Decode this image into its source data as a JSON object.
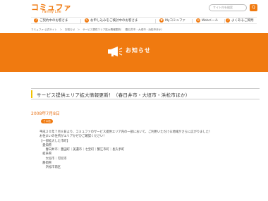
{
  "header": {
    "logo": "コミュファ",
    "logo_sub": "Family Life",
    "search_placeholder": "サイト内を検索",
    "search_button": "Q"
  },
  "nav": {
    "items": [
      {
        "icon": "?",
        "label": "ご契約中のお客さま"
      },
      {
        "icon": "✎",
        "label": "お申し込みをご検討中のお客さま"
      },
      {
        "icon": "♥",
        "label": "Myコミュファ"
      },
      {
        "icon": "✉",
        "label": "Webメール"
      },
      {
        "icon": "?",
        "label": "よくあるご質問"
      }
    ]
  },
  "breadcrumb": "コミュファ 公式サイト　＞　お知らせ　＞　サービス提供エリア拡大情報更新！（春日井市・大垣市・浜松市ほか）",
  "banner": {
    "title": "お知らせ"
  },
  "article": {
    "title": "サービス提供エリア拡大情報更新！（春日井市・大垣市・浜松市ほか）",
    "date": "2008年7月8日",
    "category": "その他",
    "lines": [
      "平成２０年７月８日より、コミュファのサービス提供エリア内の一部において、ご利用いただける地域がさらに広がりました！",
      "お住まいの住所がエリアかぜひご確認ください！",
      "",
      "【一部拡大した市町】",
      "　愛知県",
      "　　春日井市｜豊田町｜美濃市｜七宝町｜蟹江市町｜長久手町",
      "　岐阜県",
      "　　大垣市｜可児市",
      "",
      "　静岡県",
      "　　浜松市南区"
    ]
  },
  "colors": {
    "accent": "#f07a10",
    "title_bar": "#f2c200",
    "date": "#e8741a"
  }
}
